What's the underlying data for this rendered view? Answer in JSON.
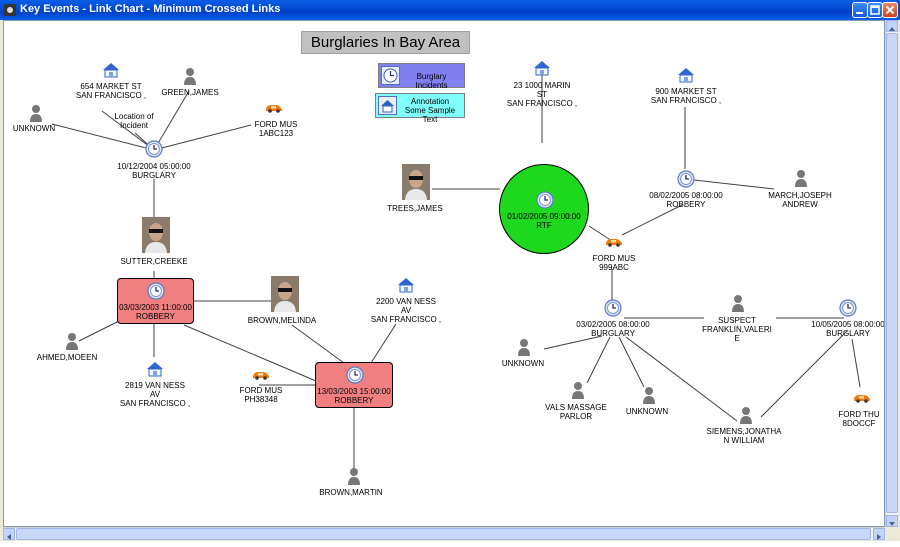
{
  "window": {
    "title": "Key Events - Link Chart - Minimum Crossed Links"
  },
  "chart": {
    "title": "Burglaries In Bay Area",
    "legend": [
      {
        "label": "Burglary Incidents",
        "color": "#8080F0"
      },
      {
        "label": "Annotation Some Sample Text",
        "line1": "Annotation",
        "line2": "Some Sample Text",
        "color": "#80FFFF"
      }
    ],
    "colors": {
      "robbery_box": "#F08080",
      "rtf_circle": "#1ED81E",
      "link": "#404040"
    },
    "events": {
      "e1": {
        "line1": "10/12/2004 05:00:00",
        "line2": "BURGLARY"
      },
      "e2": {
        "line1": "03/03/2003 11:00:00",
        "line2": "ROBBERY"
      },
      "e3": {
        "line1": "13/03/2003 15:00:00",
        "line2": "ROBBERY"
      },
      "e4": {
        "line1": "01/02/2005 09:00:00",
        "line2": "RTF"
      },
      "e5": {
        "line1": "08/02/2005 08:00:00",
        "line2": "ROBBERY"
      },
      "e6": {
        "line1": "03/02/2005 08:00:00",
        "line2": "BURGLARY"
      },
      "e7": {
        "line1": "10/05/2005 08:00:00",
        "line2": "BURGLARY"
      }
    },
    "entities": {
      "addr1": {
        "l1": "654 MARKET ST",
        "l2": "SAN FRANCISCO ,"
      },
      "green": {
        "l1": "GREEN,JAMES"
      },
      "unk1": {
        "l1": "UNKNOWN"
      },
      "loc": {
        "l1": "Location of",
        "l2": "Incident"
      },
      "car1": {
        "l1": "FORD MUS",
        "l2": "1ABC123"
      },
      "sutter": {
        "l1": "SUTTER,CREEKE"
      },
      "ahmed": {
        "l1": "AHMED,MOEEN"
      },
      "addr2": {
        "l1": "2819 VAN NESS",
        "l2": "AV",
        "l3": "SAN FRANCISCO ,"
      },
      "brownm": {
        "l1": "BROWN,MELINDA"
      },
      "car2": {
        "l1": "FORD MUS",
        "l2": "PH38348"
      },
      "addr3": {
        "l1": "2200 VAN NESS",
        "l2": "AV",
        "l3": "SAN FRANCISCO ,"
      },
      "brownmartin": {
        "l1": "BROWN,MARTIN"
      },
      "addr4": {
        "l1": "23    1000 MARIN",
        "l2": "ST",
        "l3": "SAN FRANCISCO ,"
      },
      "trees": {
        "l1": "TREES,JAMES"
      },
      "addr5": {
        "l1": "900 MARKET ST",
        "l2": "SAN FRANCISCO ,"
      },
      "march": {
        "l1": "MARCH,JOSEPH",
        "l2": "ANDREW"
      },
      "car3": {
        "l1": "FORD MUS",
        "l2": "999ABC"
      },
      "unk2": {
        "l1": "UNKNOWN"
      },
      "suspect": {
        "l1": "SUSPECT",
        "l2": "FRANKLIN,VALERI",
        "l3": "E"
      },
      "vals": {
        "l1": "VALS MASSAGE",
        "l2": "PARLOR"
      },
      "unk3": {
        "l1": "UNKNOWN"
      },
      "siemens": {
        "l1": "SIEMENS,JONATHA",
        "l2": "N WILLIAM"
      },
      "car4": {
        "l1": "FORD THU",
        "l2": "8DOCCF"
      }
    }
  }
}
